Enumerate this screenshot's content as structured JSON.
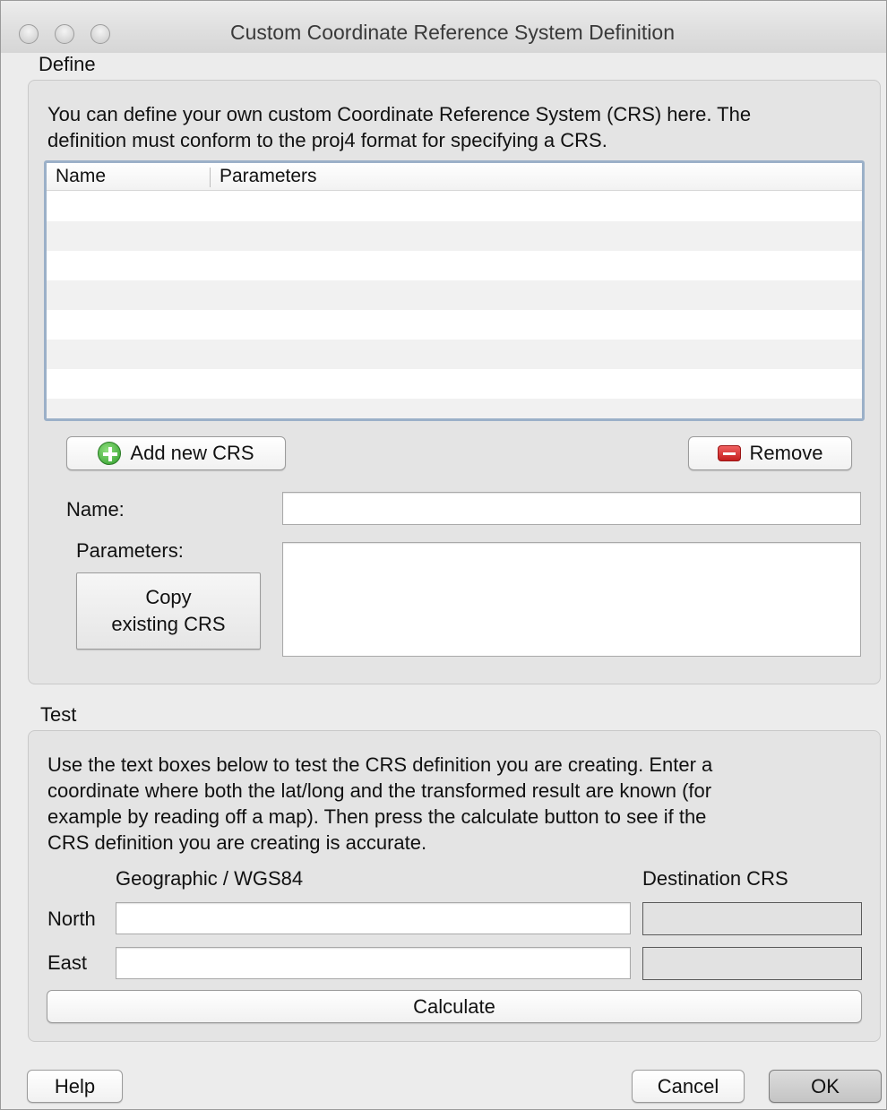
{
  "window": {
    "title": "Custom Coordinate Reference System Definition"
  },
  "define": {
    "section_label": "Define",
    "description_line1": "You can define your own custom Coordinate Reference System (CRS) here. The",
    "description_line2": "definition must conform to the proj4 format for specifying a CRS.",
    "table": {
      "columns": [
        "Name",
        "Parameters"
      ],
      "rows": []
    },
    "add_button": "Add new CRS",
    "remove_button": "Remove",
    "name_label": "Name:",
    "name_value": "",
    "parameters_label": "Parameters:",
    "parameters_value": "",
    "copy_button_line1": "Copy",
    "copy_button_line2": "existing CRS"
  },
  "test": {
    "section_label": "Test",
    "description_lines": [
      "Use the text boxes below to test the CRS definition you are creating. Enter a",
      "coordinate where both the lat/long and the transformed result are known (for",
      "example by reading off a map). Then press the calculate button to see if the",
      "CRS definition you are creating is accurate."
    ],
    "geo_header": "Geographic / WGS84",
    "dest_header": "Destination CRS",
    "north_label": "North",
    "east_label": "East",
    "north_value": "",
    "east_value": "",
    "calculate_button": "Calculate"
  },
  "footer": {
    "help_button": "Help",
    "cancel_button": "Cancel",
    "ok_button": "OK"
  },
  "colors": {
    "window_bg": "#ececec",
    "group_bg": "#e4e4e4",
    "table_focus_border": "#9bb0c8",
    "add_icon": "#2e9c2a",
    "remove_icon": "#c41e1e"
  },
  "icons": {
    "add": "plus-circle-icon",
    "remove": "minus-icon"
  }
}
